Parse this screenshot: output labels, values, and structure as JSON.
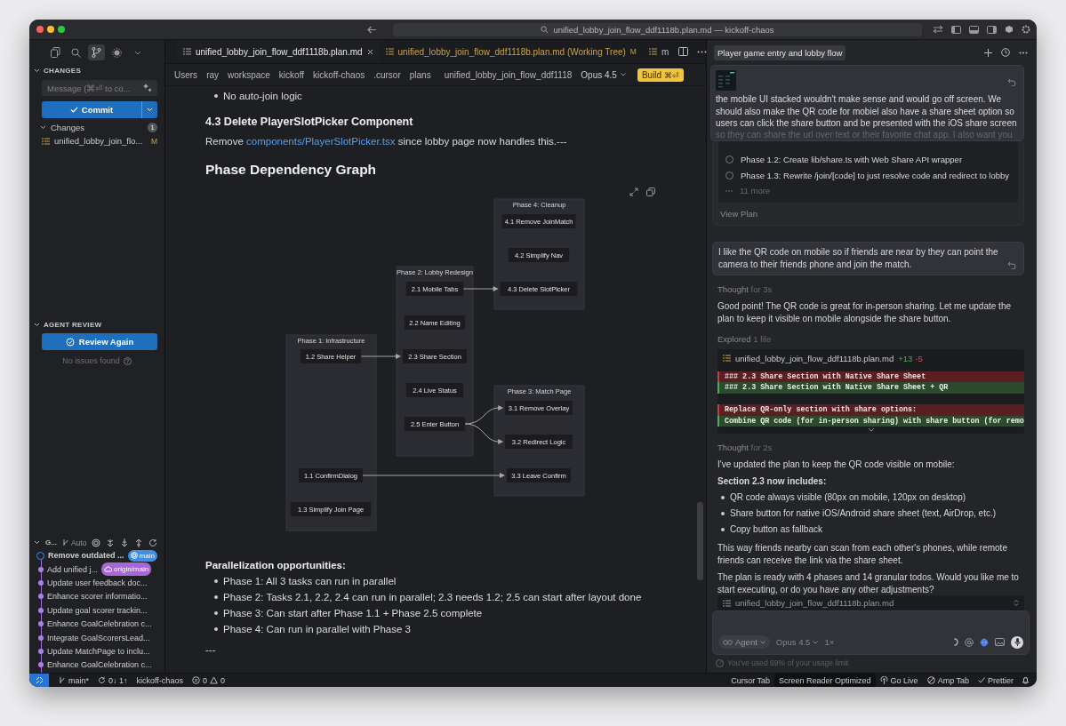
{
  "window": {
    "title": "unified_lobby_join_flow_ddf1118b.plan.md — kickoff-chaos"
  },
  "sidebar": {
    "activity_bar": [
      {
        "selected": false
      },
      {
        "selected": false
      },
      {
        "selected": true
      },
      {
        "selected": false
      },
      {
        "selected": false
      }
    ],
    "changes": {
      "header": "CHANGES",
      "message_placeholder": "Message (⌘⏎ to co...",
      "commit_label": "Commit",
      "group_label": "Changes",
      "count": "1",
      "files": [
        {
          "name": "unified_lobby_join_flo...",
          "status": "M"
        }
      ]
    },
    "agent_review": {
      "header": "AGENT REVIEW",
      "button": "Review Again",
      "status": "No issues found"
    },
    "graph": {
      "header": "G...",
      "mode": "Auto",
      "commits": [
        {
          "message": "Remove outdated ...",
          "current": true,
          "ref": {
            "kind": "local",
            "label": "main"
          }
        },
        {
          "message": "Add unified j...",
          "current": false,
          "ref": {
            "kind": "remote",
            "label": "origin/main"
          }
        },
        {
          "message": "Update user feedback doc...",
          "current": false
        },
        {
          "message": "Enhance scorer informatio...",
          "current": false
        },
        {
          "message": "Update goal scorer trackin...",
          "current": false
        },
        {
          "message": "Enhance GoalCelebration c...",
          "current": false
        },
        {
          "message": "Integrate GoalScorersLead...",
          "current": false
        },
        {
          "message": "Update MatchPage to inclu...",
          "current": false
        },
        {
          "message": "Enhance GoalCelebration c...",
          "current": false
        }
      ]
    }
  },
  "editor": {
    "tabs": [
      {
        "label": "unified_lobby_join_flow_ddf1118b.plan.md",
        "selected": true
      },
      {
        "label": "unified_lobby_join_flow_ddf1118b.plan.md (Working Tree)",
        "selected": false,
        "badge": "M"
      },
      {
        "label": "m",
        "selected": false
      }
    ],
    "breadcrumb": [
      "Users",
      "ray",
      "workspace",
      "kickoff",
      "kickoff-chaos",
      ".cursor",
      "plans",
      "unified_lobby_join_flow_ddf1118"
    ],
    "model": "Opus 4.5",
    "build": {
      "label": "Build",
      "shortcut": "⌘⏎"
    },
    "blocks": [
      {
        "kind": "bullet",
        "text": "No auto-join logic"
      },
      {
        "kind": "heading3",
        "text": "4.3 Delete PlayerSlotPicker Component"
      },
      {
        "kind": "paragraph",
        "before": "Remove ",
        "link": "components/PlayerSlotPicker.tsx",
        "after": " since lobby page now handles this.---"
      },
      {
        "kind": "heading2",
        "text": "Phase Dependency Graph"
      },
      {
        "kind": "diagram",
        "clusters": [
          {
            "title": "Phase 4: Cleanup",
            "nodes": [
              "4.1 Remove JoinMatch",
              "4.2 Simplify Nav",
              "4.3 Delete SlotPicker"
            ]
          },
          {
            "title": "Phase 2: Lobby Redesign",
            "nodes": [
              "2.1 Mobile Tabs",
              "2.2 Name Editing",
              "2.3 Share Section",
              "2.4 Live Status",
              "2.5 Enter Button"
            ]
          },
          {
            "title": "Phase 1: Infrastructure",
            "nodes": [
              "1.2 Share Helper",
              "1.1 ConfirmDialog",
              "1.3 Simplify Join Page"
            ]
          },
          {
            "title": "Phase 3: Match Page",
            "nodes": [
              "3.1 Remove Overlay",
              "3.2 Redirect Logic",
              "3.3 Leave Confirm"
            ]
          }
        ]
      },
      {
        "kind": "strong",
        "text": "Parallelization opportunities:"
      },
      {
        "kind": "bullet",
        "text": "Phase 1: All 3 tasks can run in parallel"
      },
      {
        "kind": "bullet",
        "text": "Phase 2: Tasks 2.1, 2.2, 2.4 can run in parallel; 2.3 needs 1.2; 2.5 can start after layout done"
      },
      {
        "kind": "bullet",
        "text": "Phase 3: Can start after Phase 1.1 + Phase 2.5 complete"
      },
      {
        "kind": "bullet",
        "text": "Phase 4: Can run in parallel with Phase 3"
      },
      {
        "kind": "rule",
        "text": "---"
      }
    ]
  },
  "chat": {
    "title": "Player game entry and lobby flow",
    "pinned": {
      "text": "the mobile UI stacked wouldn't make sense and would go off screen. We should also make the QR code for mobiel also have a share sheet option so users can click the share button and be presented with the iOS share screen",
      "faded_text": "so they can share the url over text or their favorite chat app. I also want you"
    },
    "thread": [
      {
        "kind": "plan",
        "todos": [
          {
            "text": "Phase 1.2: Create lib/share.ts with Web Share API wrapper",
            "done": false
          },
          {
            "text": "Phase 1.3: Rewrite /join/[code] to just resolve code and redirect to lobby",
            "done": false
          }
        ],
        "more": "11 more",
        "action": "View Plan"
      },
      {
        "kind": "user",
        "text": "I like the QR code on mobile so if friends are near by they can point the camera to their friends phone and join the match."
      },
      {
        "kind": "thought",
        "label": "Thought",
        "detail": "for 3s"
      },
      {
        "kind": "text",
        "text": "Good point! The QR code is great for in-person sharing. Let me update the plan to keep it visible on mobile alongside the share button."
      },
      {
        "kind": "thought",
        "label": "Explored",
        "detail": "1 file"
      },
      {
        "kind": "diff",
        "file": "unified_lobby_join_flow_ddf1118b.plan.md",
        "added": "+13",
        "removed": "-5",
        "lines": [
          {
            "kind": "del",
            "text": "### 2.3 Share Section with Native Share Sheet"
          },
          {
            "kind": "add",
            "text": "### 2.3 Share Section with Native Share Sheet + QR"
          },
          {
            "kind": "blank"
          },
          {
            "kind": "del",
            "text": "Replace QR-only section with share options:"
          },
          {
            "kind": "add",
            "text": "Combine QR code (for in-person sharing) with share button (for remo"
          }
        ]
      },
      {
        "kind": "thought",
        "label": "Thought",
        "detail": "for 2s"
      },
      {
        "kind": "text",
        "text": "I've updated the plan to keep the QR code visible on mobile:"
      },
      {
        "kind": "subheading",
        "text": "Section 2.3 now includes:"
      },
      {
        "kind": "bullets",
        "items": [
          "QR code always visible (80px on mobile, 120px on desktop)",
          "Share button for native iOS/Android share sheet (text, AirDrop, etc.)",
          "Copy button as fallback"
        ]
      },
      {
        "kind": "text",
        "text": "This way friends nearby can scan from each other's phones, while remote friends can receive the link via the share sheet."
      },
      {
        "kind": "text",
        "text": "The plan is ready with 4 phases and 14 granular todos. Would you like me to start executing, or do you have any other adjustments?"
      }
    ],
    "attachment": "unified_lobby_join_flow_ddf1118b.plan.md",
    "composer": {
      "mode": "Agent",
      "model": "Opus 4.5",
      "multiplier": "1×"
    },
    "usage": "You've used 69% of your usage limit"
  },
  "status_bar": {
    "branch": "main*",
    "sync": "0↓ 1↑",
    "project": "kickoff-chaos",
    "errors": "0",
    "warnings": "0",
    "items": [
      {
        "label": "Cursor Tab",
        "selected": false
      },
      {
        "label": "Screen Reader Optimized",
        "selected": true
      },
      {
        "label": "Go Live",
        "selected": false
      },
      {
        "label": "Amp Tab",
        "selected": false
      },
      {
        "label": "Prettier",
        "selected": false
      }
    ]
  }
}
